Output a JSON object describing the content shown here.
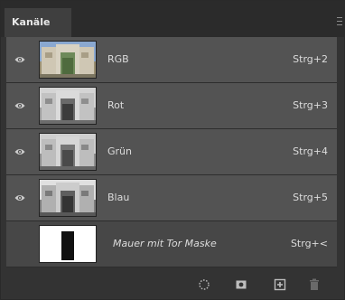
{
  "panel": {
    "tab_label": "Kanäle"
  },
  "channels": [
    {
      "name": "RGB",
      "shortcut": "Strg+2",
      "visible": true,
      "thumb": "color"
    },
    {
      "name": "Rot",
      "shortcut": "Strg+3",
      "visible": true,
      "thumb": "gray-light"
    },
    {
      "name": "Grün",
      "shortcut": "Strg+4",
      "visible": true,
      "thumb": "gray-mid"
    },
    {
      "name": "Blau",
      "shortcut": "Strg+5",
      "visible": true,
      "thumb": "gray-dark"
    },
    {
      "name": "Mauer mit Tor Maske",
      "shortcut": "Strg+<",
      "visible": false,
      "thumb": "mask"
    }
  ],
  "footer": {
    "buttons": [
      "load-selection-icon",
      "save-selection-icon",
      "new-channel-icon",
      "delete-channel-icon"
    ]
  },
  "colors": {
    "panel_bg": "#333333",
    "row_bg": "#535353",
    "mask_row_bg": "#474747",
    "text": "#dcdcdc"
  }
}
